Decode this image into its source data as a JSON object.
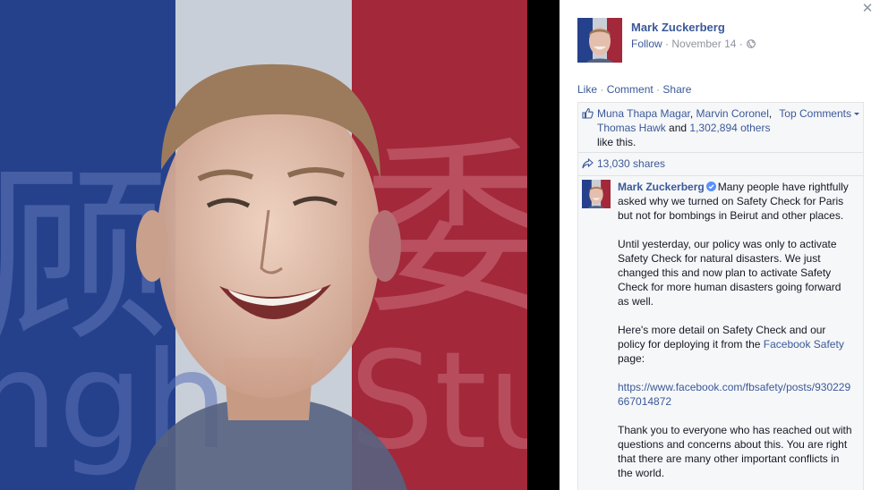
{
  "post": {
    "author_name": "Mark Zuckerberg",
    "follow_label": "Follow",
    "date": "November 14",
    "separator": "·"
  },
  "actions": {
    "like": "Like",
    "comment": "Comment",
    "share": "Share"
  },
  "likes": {
    "names": [
      "Muna Thapa Magar",
      "Marvin Coronel",
      "Thomas Hawk"
    ],
    "and_text": "and",
    "others": "1,302,894 others",
    "suffix": "like this."
  },
  "top_comments_label": "Top Comments",
  "shares_label": "13,030 shares",
  "comment": {
    "author": "Mark Zuckerberg",
    "p1": "Many people have rightfully asked why we turned on Safety Check for Paris but not for bombings in Beirut and other places.",
    "p2": "Until yesterday, our policy was only to activate Safety Check for natural disasters. We just changed this and now plan to activate Safety Check for more human disasters going forward as well.",
    "p3_before": "Here's more detail on Safety Check and our policy for deploying it from the",
    "p3_link": "Facebook Safety",
    "p3_after": "page:",
    "url": "https://www.facebook.com/fbsafety/posts/930229667014872",
    "p5": "Thank you to everyone who has reached out with questions and concerns about this. You are right that there are many other important conflicts in the world."
  },
  "photo": {
    "flag_colors": {
      "blue": "#26418c",
      "white": "#c9cfd9",
      "red": "#a2283a"
    },
    "bg_text_left": "顾",
    "bg_text_right": "委",
    "bg_word_left": "ngh",
    "bg_word_right": "Stu"
  },
  "icons": {
    "close": "close-icon",
    "globe": "globe-icon",
    "like": "like-thumb-icon",
    "share": "share-arrow-icon",
    "verified": "verified-badge-icon"
  }
}
